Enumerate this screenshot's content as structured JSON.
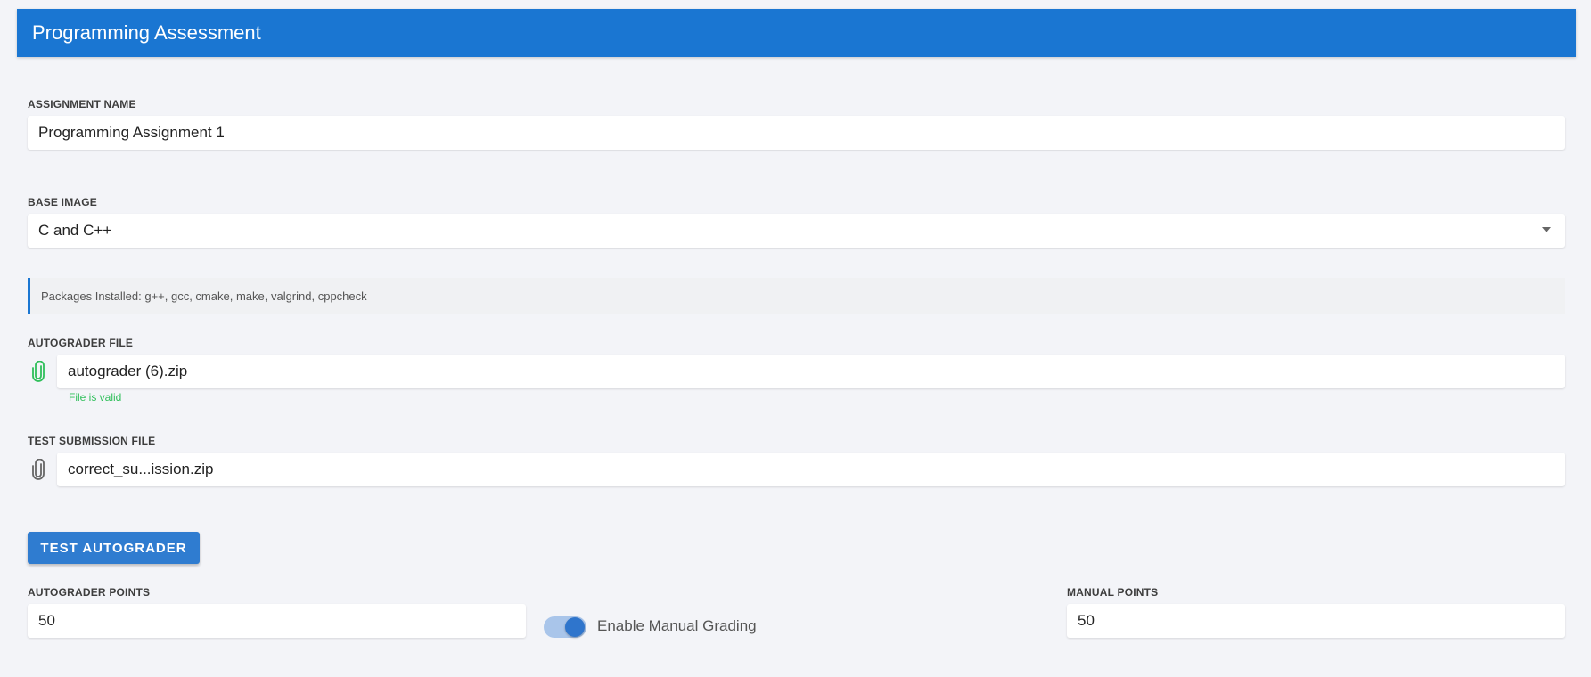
{
  "header": {
    "title": "Programming Assessment"
  },
  "assignment_name": {
    "label": "ASSIGNMENT NAME",
    "value": "Programming Assignment 1"
  },
  "base_image": {
    "label": "BASE IMAGE",
    "value": "C and C++"
  },
  "packages_info": "Packages Installed: g++, gcc, cmake, make, valgrind, cppcheck",
  "autograder_file": {
    "label": "AUTOGRADER FILE",
    "value": "autograder (6).zip",
    "status": "File is valid",
    "status_color": "#2fbf5a",
    "icon": "paperclip-icon"
  },
  "test_submission_file": {
    "label": "TEST SUBMISSION FILE",
    "value": "correct_su...ission.zip",
    "icon": "paperclip-icon"
  },
  "test_button": {
    "label": "TEST AUTOGRADER"
  },
  "autograder_points": {
    "label": "AUTOGRADER POINTS",
    "value": "50"
  },
  "manual_grading": {
    "label": "Enable Manual Grading",
    "enabled": true
  },
  "manual_points": {
    "label": "MANUAL POINTS",
    "value": "50"
  },
  "colors": {
    "accent": "#1a76d2",
    "background": "#f3f4f8"
  }
}
